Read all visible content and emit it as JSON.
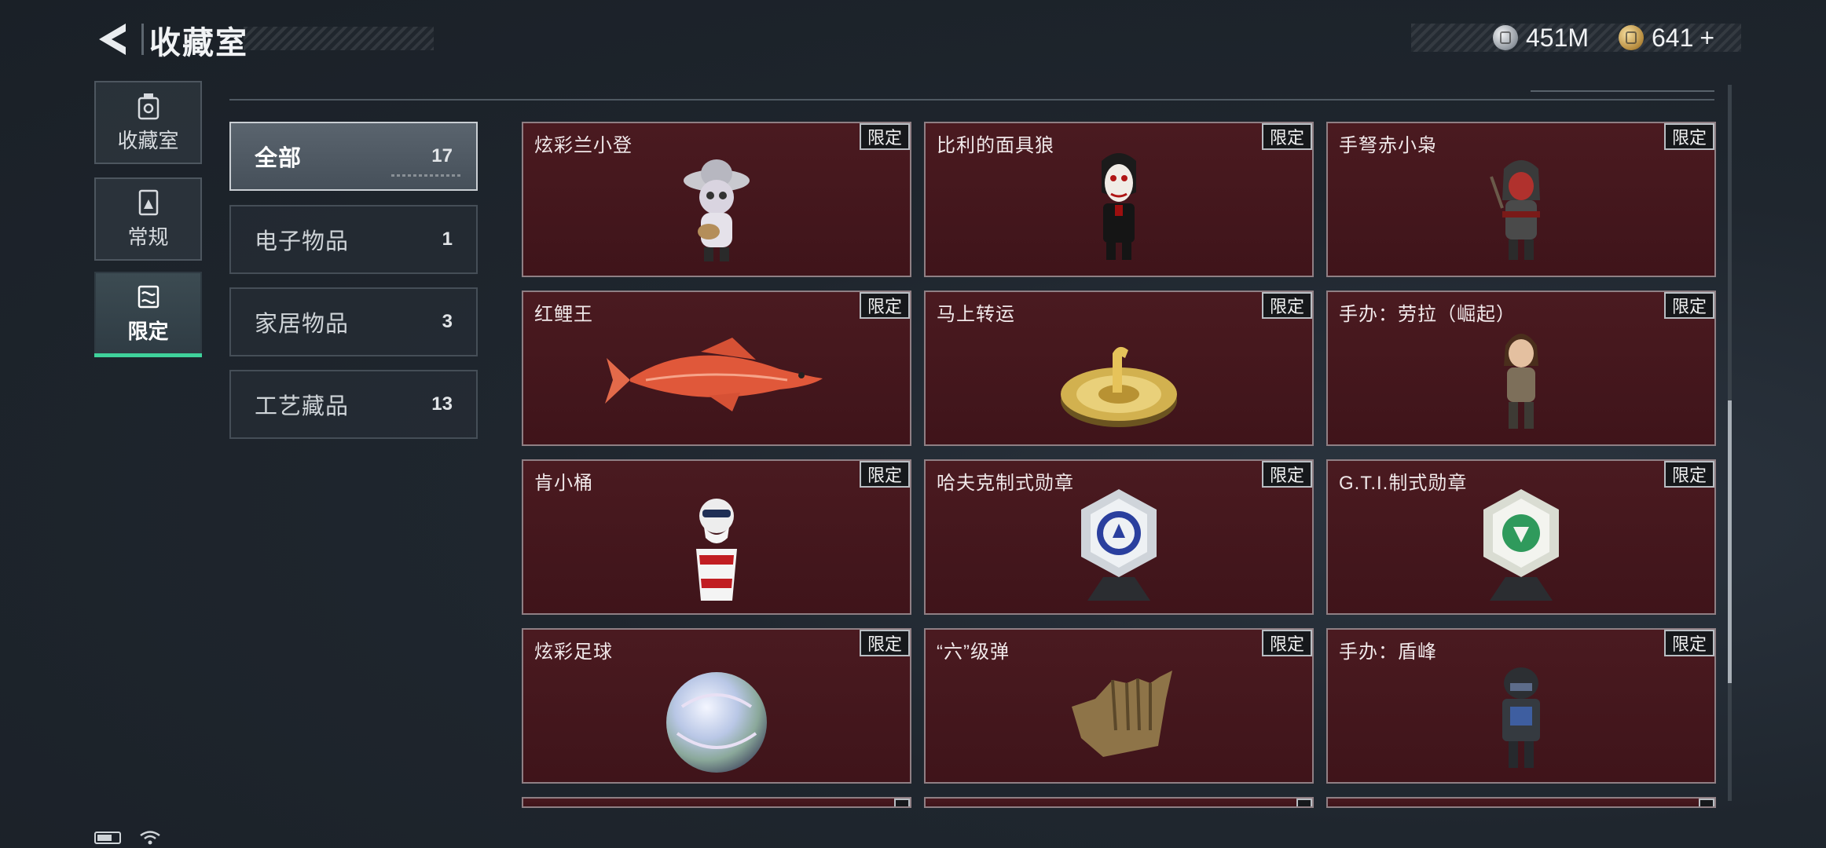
{
  "header": {
    "title": "收藏室",
    "currencies": [
      {
        "icon": "silver-coin-icon",
        "value": "451M"
      },
      {
        "icon": "gold-coin-icon",
        "value": "641"
      }
    ],
    "add_label": "+"
  },
  "nav": [
    {
      "label": "收藏室",
      "icon": "collection-room-icon",
      "active": false
    },
    {
      "label": "常规",
      "icon": "regular-items-icon",
      "active": false
    },
    {
      "label": "限定",
      "icon": "limited-items-icon",
      "active": true
    }
  ],
  "categories": [
    {
      "name": "全部",
      "count": "17",
      "active": true
    },
    {
      "name": "电子物品",
      "count": "1",
      "active": false
    },
    {
      "name": "家居物品",
      "count": "3",
      "active": false
    },
    {
      "name": "工艺藏品",
      "count": "13",
      "active": false
    }
  ],
  "badge_label": "限定",
  "items": [
    {
      "name": "炫彩兰小登",
      "art": "figurine-sombrero-icon"
    },
    {
      "name": "比利的面具狼",
      "art": "jigsaw-puppet-icon"
    },
    {
      "name": "手弩赤小枭",
      "art": "hooded-figurine-icon"
    },
    {
      "name": "红鲤王",
      "art": "red-carp-icon"
    },
    {
      "name": "马上转运",
      "art": "golden-horse-wheel-icon"
    },
    {
      "name": "手办：劳拉（崛起）",
      "art": "lara-figurine-icon"
    },
    {
      "name": "肯小桶",
      "art": "colonel-bucket-icon"
    },
    {
      "name": "哈夫克制式勋章",
      "art": "blue-medal-icon"
    },
    {
      "name": "G.T.I.制式勋章",
      "art": "green-medal-icon"
    },
    {
      "name": "炫彩足球",
      "art": "iridescent-ball-icon"
    },
    {
      "name": "“六”级弹",
      "art": "bronze-hand-icon"
    },
    {
      "name": "手办：盾峰",
      "art": "armored-soldier-icon"
    }
  ],
  "colors": {
    "accent": "#3fd29b",
    "card_bg": "#4a1a20",
    "page_bg": "#1f262e"
  }
}
